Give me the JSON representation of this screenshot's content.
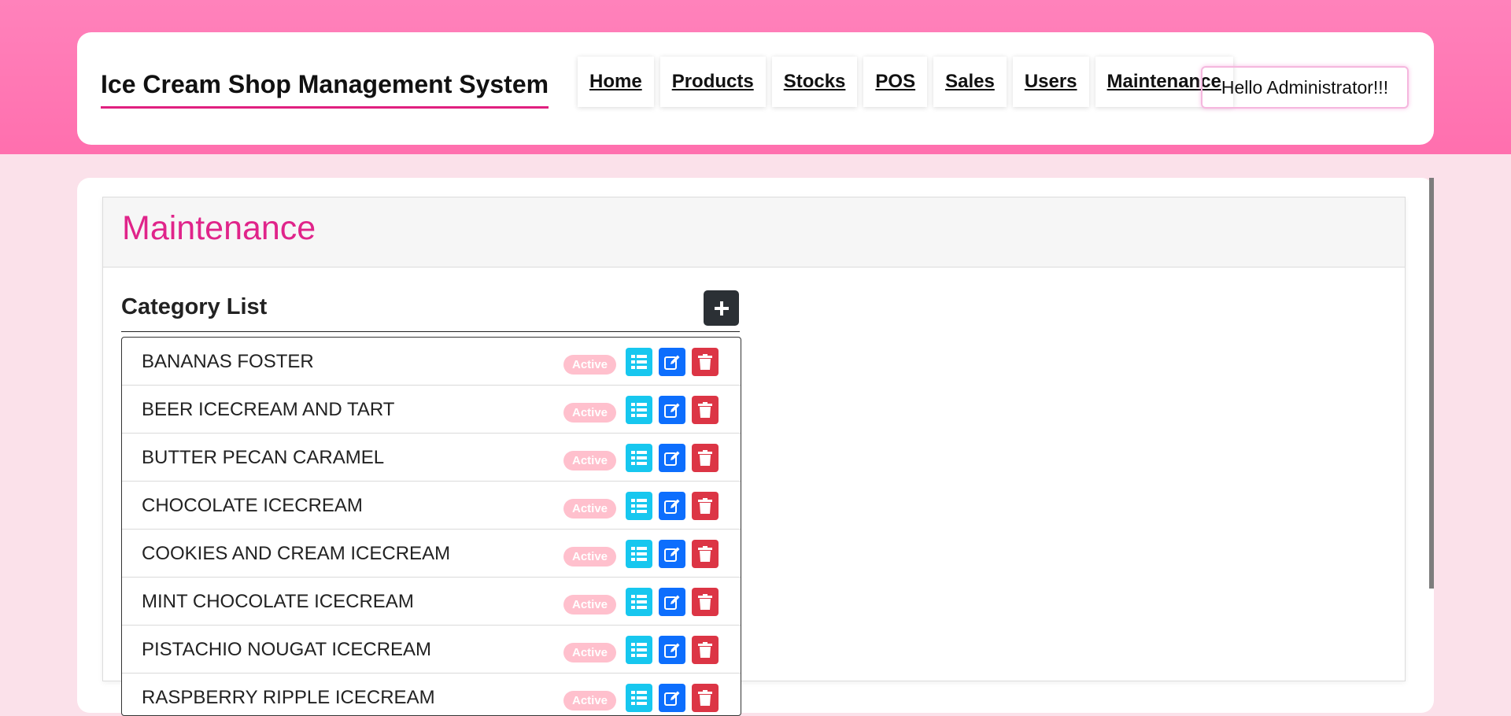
{
  "app": {
    "title": "Ice Cream Shop Management System"
  },
  "nav": {
    "items": [
      {
        "label": "Home"
      },
      {
        "label": "Products"
      },
      {
        "label": "Stocks"
      },
      {
        "label": "POS"
      },
      {
        "label": "Sales"
      },
      {
        "label": "Users"
      },
      {
        "label": "Maintenance"
      }
    ],
    "greeting": "Hello Administrator!!!"
  },
  "page": {
    "title": "Maintenance"
  },
  "category_list": {
    "title": "Category List",
    "add_icon": "plus-icon",
    "items": [
      {
        "name": "BANANAS FOSTER",
        "status": "Active"
      },
      {
        "name": "BEER ICECREAM AND TART",
        "status": "Active"
      },
      {
        "name": "BUTTER PECAN CARAMEL",
        "status": "Active"
      },
      {
        "name": "CHOCOLATE ICECREAM",
        "status": "Active"
      },
      {
        "name": "COOKIES AND CREAM ICECREAM",
        "status": "Active"
      },
      {
        "name": "MINT CHOCOLATE ICECREAM",
        "status": "Active"
      },
      {
        "name": "PISTACHIO NOUGAT ICECREAM",
        "status": "Active"
      },
      {
        "name": "RASPBERRY RIPPLE ICECREAM",
        "status": "Active"
      }
    ],
    "row_actions": [
      "list-icon",
      "edit-icon",
      "trash-icon"
    ]
  },
  "colors": {
    "header_pink": "#ff78b4",
    "accent": "#e0248a",
    "view": "#17c7ef",
    "edit": "#0d6efd",
    "delete": "#dc3545",
    "badge": "#ffc0cd"
  }
}
